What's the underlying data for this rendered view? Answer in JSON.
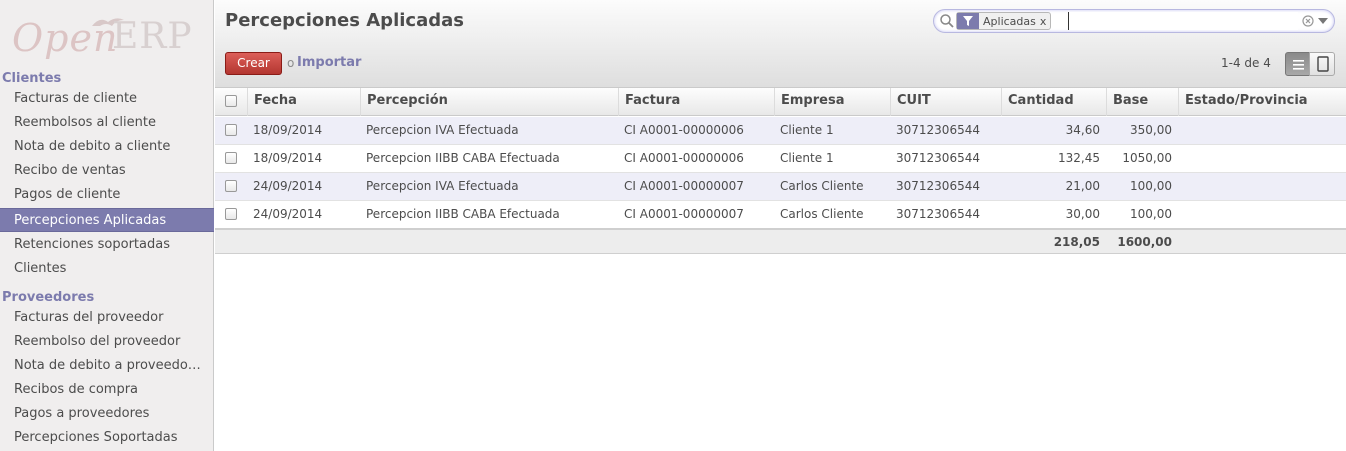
{
  "logo": {
    "open": "Open",
    "erp": "ERP"
  },
  "sidebar": {
    "clientes_header": "Clientes",
    "clientes_items": [
      "Facturas de cliente",
      "Reembolsos al cliente",
      "Nota de debito a cliente",
      "Recibo de ventas",
      "Pagos de cliente",
      "Percepciones Aplicadas",
      "Retenciones soportadas",
      "Clientes"
    ],
    "active_item": "Percepciones Aplicadas",
    "proveedores_header": "Proveedores",
    "proveedores_items": [
      "Facturas del proveedor",
      "Reembolso del proveedor",
      "Nota de debito a proveedo…",
      "Recibos de compra",
      "Pagos a proveedores",
      "Percepciones Soportadas"
    ]
  },
  "header": {
    "title": "Percepciones Aplicadas",
    "search": {
      "facet_label": "Aplicadas",
      "facet_remove": "x",
      "value": "",
      "search_icon": "magnifier-icon",
      "facet_icon": "filter-icon"
    },
    "create_label": "Crear",
    "or_label": "o",
    "import_label": "Importar",
    "pager": "1-4 de 4"
  },
  "table": {
    "columns": [
      "Fecha",
      "Percepción",
      "Factura",
      "Empresa",
      "CUIT",
      "Cantidad",
      "Base",
      "Estado/Provincia"
    ],
    "rows": [
      {
        "fecha": "18/09/2014",
        "percepcion": "Percepcion IVA Efectuada",
        "factura": "CI A0001-00000006",
        "empresa": "Cliente 1",
        "cuit": "30712306544",
        "cantidad": "34,60",
        "base": "350,00",
        "estado": ""
      },
      {
        "fecha": "18/09/2014",
        "percepcion": "Percepcion IIBB CABA Efectuada",
        "factura": "CI A0001-00000006",
        "empresa": "Cliente 1",
        "cuit": "30712306544",
        "cantidad": "132,45",
        "base": "1050,00",
        "estado": ""
      },
      {
        "fecha": "24/09/2014",
        "percepcion": "Percepcion IVA Efectuada",
        "factura": "CI A0001-00000007",
        "empresa": "Carlos Cliente",
        "cuit": "30712306544",
        "cantidad": "21,00",
        "base": "100,00",
        "estado": ""
      },
      {
        "fecha": "24/09/2014",
        "percepcion": "Percepcion IIBB CABA Efectuada",
        "factura": "CI A0001-00000007",
        "empresa": "Carlos Cliente",
        "cuit": "30712306544",
        "cantidad": "30,00",
        "base": "100,00",
        "estado": ""
      }
    ],
    "totals": {
      "cantidad": "218,05",
      "base": "1600,00"
    }
  },
  "colors": {
    "accent": "#7c7bad",
    "create_button": "#c33d37",
    "row_odd": "#eeeef8"
  }
}
